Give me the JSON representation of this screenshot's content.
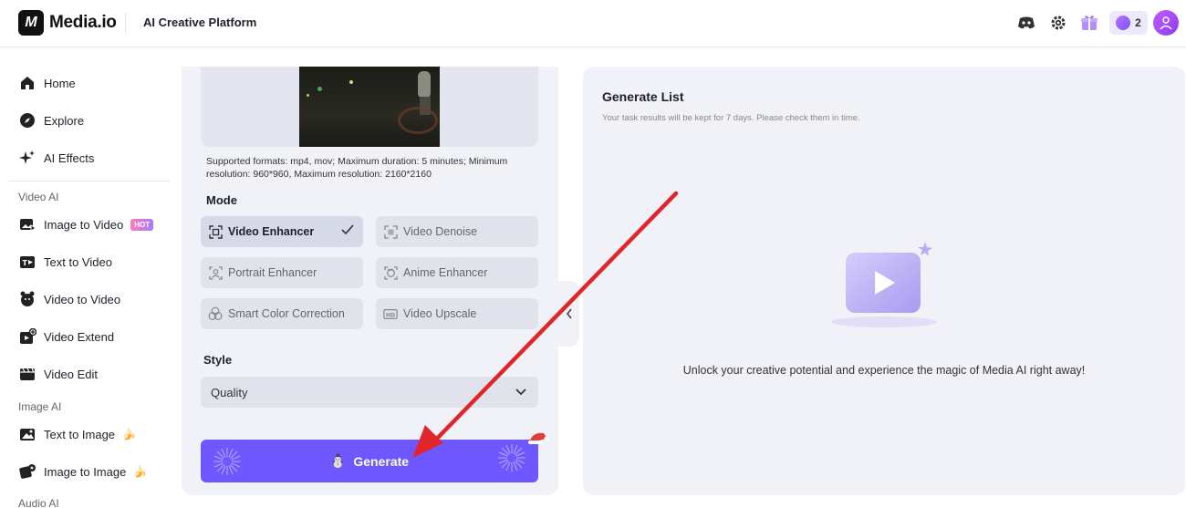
{
  "header": {
    "logo_text": "Media.io",
    "logo_mark": "M",
    "platform_title": "AI Creative Platform",
    "credits_count": "2",
    "icons": [
      "discord-icon",
      "settings-icon",
      "gift-icon",
      "credits-icon",
      "user-avatar-icon"
    ]
  },
  "sidebar": {
    "main_items": [
      {
        "label": "Home",
        "icon": "home-icon"
      },
      {
        "label": "Explore",
        "icon": "compass-icon"
      },
      {
        "label": "AI Effects",
        "icon": "sparkle-icon"
      }
    ],
    "video_ai_label": "Video AI",
    "video_items": [
      {
        "label": "Image to Video",
        "icon": "image-video-icon",
        "badge": "HOT"
      },
      {
        "label": "Text to Video",
        "icon": "text-video-icon"
      },
      {
        "label": "Video to Video",
        "icon": "video-video-icon"
      },
      {
        "label": "Video Extend",
        "icon": "video-extend-icon"
      },
      {
        "label": "Video Edit",
        "icon": "video-edit-icon"
      }
    ],
    "image_ai_label": "Image AI",
    "image_items": [
      {
        "label": "Text to Image",
        "icon": "text-image-icon",
        "emoji": "🍌"
      },
      {
        "label": "Image to Image",
        "icon": "image-image-icon",
        "emoji": "🍌"
      }
    ],
    "audio_ai_label": "Audio AI"
  },
  "editor": {
    "formats_text": "Supported formats: mp4, mov; Maximum duration: 5 minutes; Minimum resolution: 960*960, Maximum resolution: 2160*2160",
    "mode_label": "Mode",
    "modes": [
      {
        "label": "Video Enhancer",
        "active": true
      },
      {
        "label": "Video Denoise",
        "active": false
      },
      {
        "label": "Portrait Enhancer",
        "active": false
      },
      {
        "label": "Anime Enhancer",
        "active": false
      },
      {
        "label": "Smart Color Correction",
        "active": false
      },
      {
        "label": "Video Upscale",
        "active": false
      }
    ],
    "style_label": "Style",
    "style_value": "Quality",
    "generate_label": "Generate",
    "generate_emoji": "⛄"
  },
  "generate_list": {
    "title": "Generate List",
    "subtitle": "Your task results will be kept for 7 days. Please check them in time.",
    "empty_message": "Unlock your creative potential and experience the magic of Media AI right away!"
  },
  "colors": {
    "accent": "#6e57ff",
    "panel_bg": "#f1f2f7",
    "annotation_arrow": "#e0262b"
  }
}
